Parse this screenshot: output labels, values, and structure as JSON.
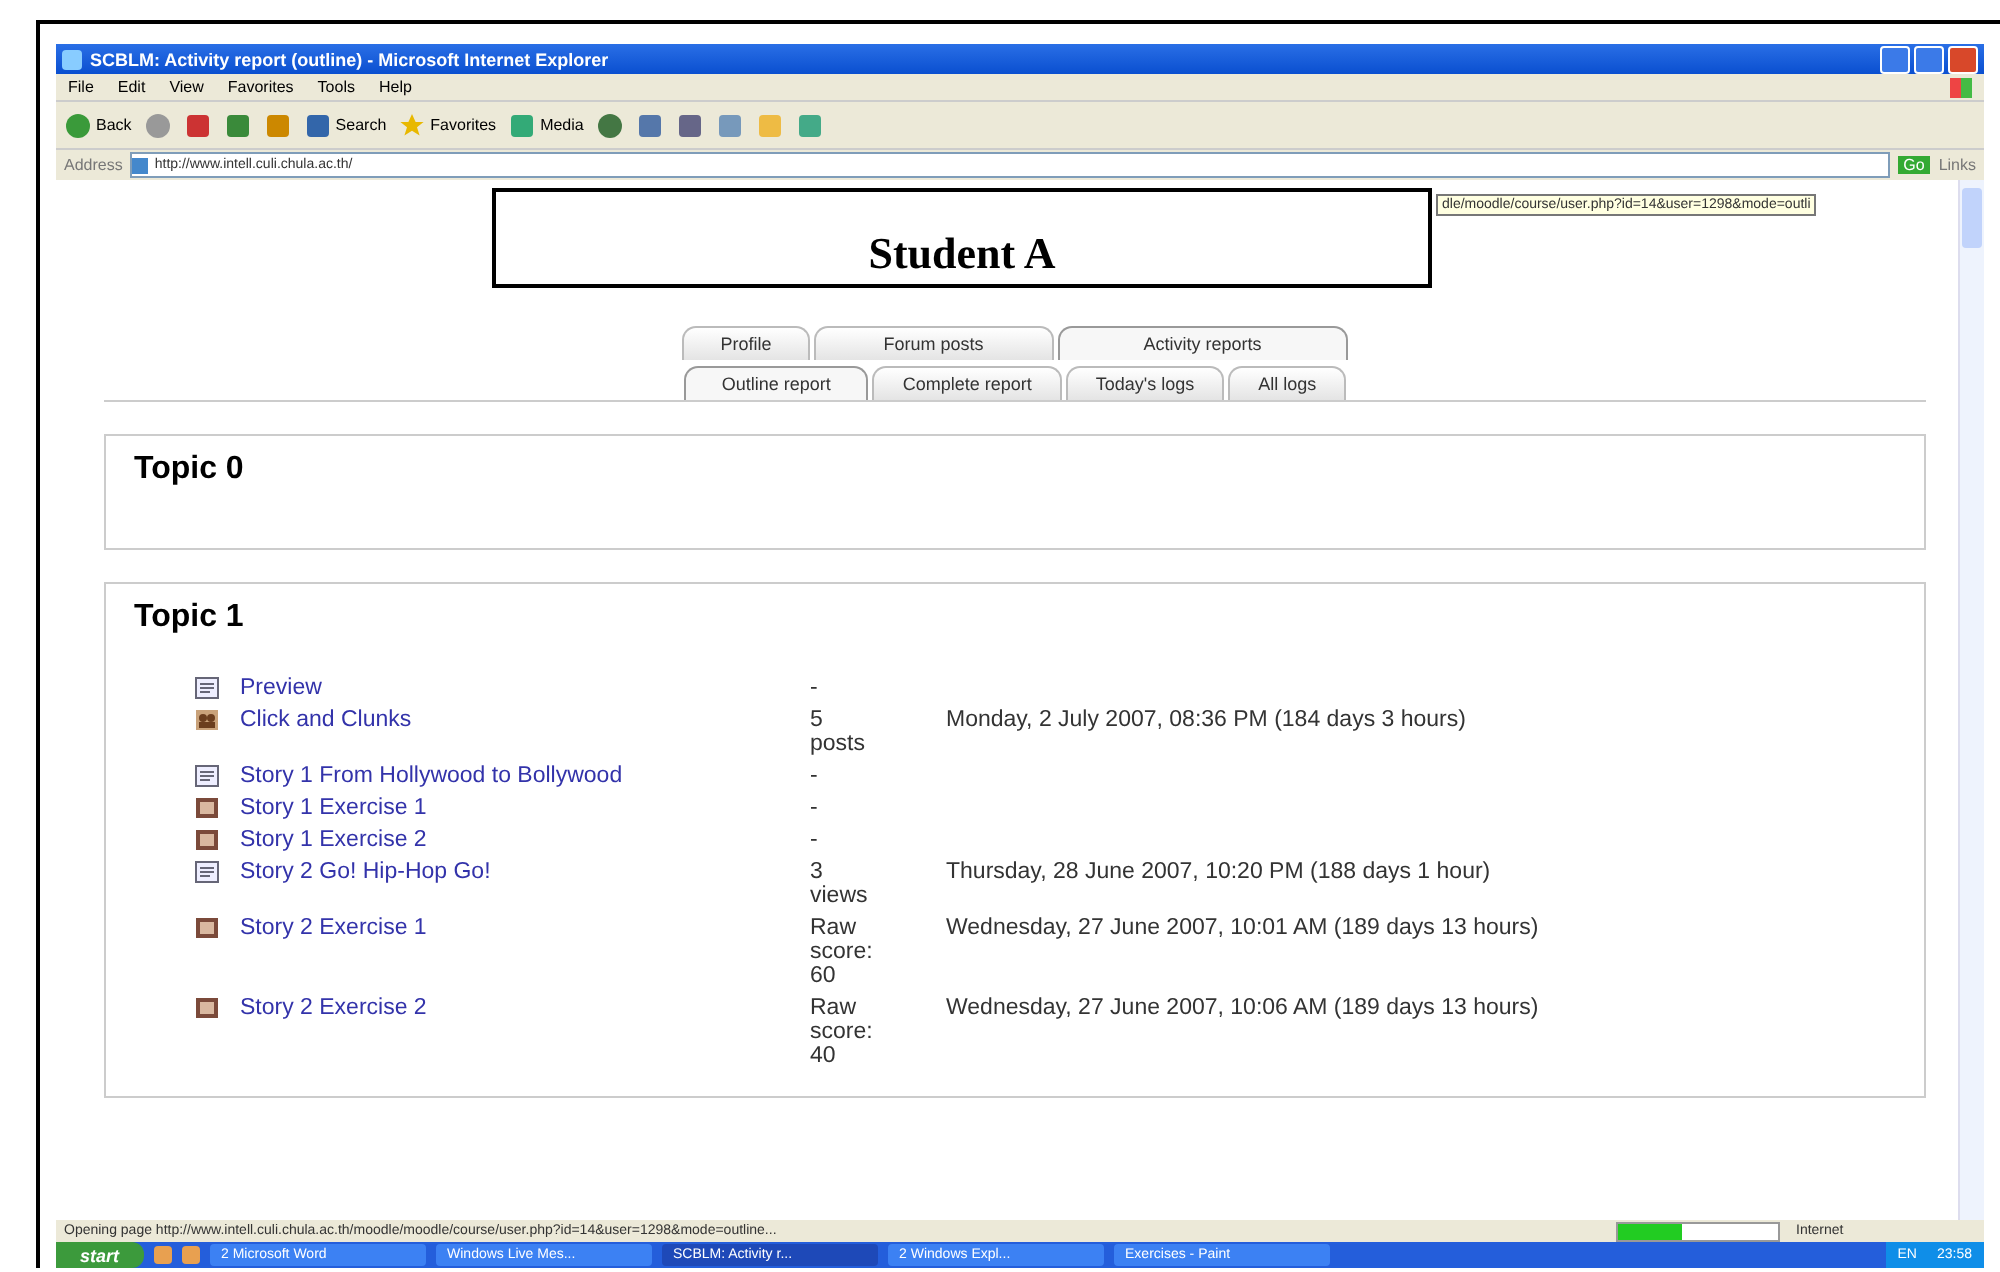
{
  "window": {
    "title": "SCBLM: Activity report (outline) - Microsoft Internet Explorer"
  },
  "menu": [
    "File",
    "Edit",
    "View",
    "Favorites",
    "Tools",
    "Help"
  ],
  "toolbar": [
    {
      "kind": "back",
      "label": "Back"
    },
    {
      "kind": "forward"
    },
    {
      "kind": "stop"
    },
    {
      "kind": "refresh"
    },
    {
      "kind": "home"
    },
    {
      "kind": "search",
      "label": "Search"
    },
    {
      "kind": "favorites",
      "label": "Favorites"
    },
    {
      "kind": "media",
      "label": "Media"
    },
    {
      "kind": "history"
    },
    {
      "kind": "mail"
    },
    {
      "kind": "print"
    },
    {
      "kind": "edit"
    },
    {
      "kind": "folder"
    },
    {
      "kind": "messenger"
    }
  ],
  "address": {
    "label": "Address",
    "value": "http://www.intell.culi.chula.ac.th/",
    "go": "Go",
    "links": "Links",
    "tooltip": "dle/moodle/course/user.php?id=14&user=1298&mode=outli"
  },
  "overlay_label": "Student A",
  "tab_rows": [
    [
      {
        "label": "Profile",
        "selected": false
      },
      {
        "label": "Forum posts",
        "selected": false
      },
      {
        "label": "Activity reports",
        "selected": true
      }
    ],
    [
      {
        "label": "Outline report",
        "selected": true
      },
      {
        "label": "Complete report",
        "selected": false
      },
      {
        "label": "Today's logs",
        "selected": false
      },
      {
        "label": "All logs",
        "selected": false
      }
    ]
  ],
  "topics": [
    {
      "title": "Topic 0"
    },
    {
      "title": "Topic 1",
      "items": [
        {
          "kind": "resource",
          "title": "Preview",
          "info": "-"
        },
        {
          "kind": "forum",
          "title": "Click and Clunks",
          "info": "5 posts",
          "date": "Monday, 2 July 2007, 08:36 PM (184 days 3 hours)"
        },
        {
          "kind": "resource",
          "title": "Story 1 From Hollywood to Bollywood",
          "info": "-"
        },
        {
          "kind": "quiz",
          "title": "Story 1 Exercise 1",
          "info": "-"
        },
        {
          "kind": "quiz",
          "title": "Story 1 Exercise 2",
          "info": "-"
        },
        {
          "kind": "resource",
          "title": "Story 2 Go! Hip-Hop Go!",
          "info": "3 views",
          "date": "Thursday, 28 June 2007, 10:20 PM (188 days 1 hour)"
        },
        {
          "kind": "quiz",
          "title": "Story 2 Exercise 1",
          "info": "Raw score: 60",
          "date": "Wednesday, 27 June 2007, 10:01 AM (189 days 13 hours)"
        },
        {
          "kind": "quiz",
          "title": "Story 2 Exercise 2",
          "info": "Raw score: 40",
          "date": "Wednesday, 27 June 2007, 10:06 AM (189 days 13 hours)"
        }
      ]
    }
  ],
  "status_bar": {
    "text": "Opening page http://www.intell.culi.chula.ac.th/moodle/moodle/course/user.php?id=14&user=1298&mode=outline...",
    "level": 0.4,
    "zone": "Internet"
  },
  "taskbar": {
    "start": "start",
    "tasks": [
      {
        "label": "2 Microsoft Word",
        "selected": false
      },
      {
        "label": "Windows Live Mes...",
        "selected": false
      },
      {
        "label": "SCBLM: Activity r...",
        "selected": true
      },
      {
        "label": "2 Windows Expl...",
        "selected": false
      },
      {
        "label": "Exercises - Paint",
        "selected": false
      }
    ],
    "lang": "EN",
    "clock": "23:58"
  }
}
